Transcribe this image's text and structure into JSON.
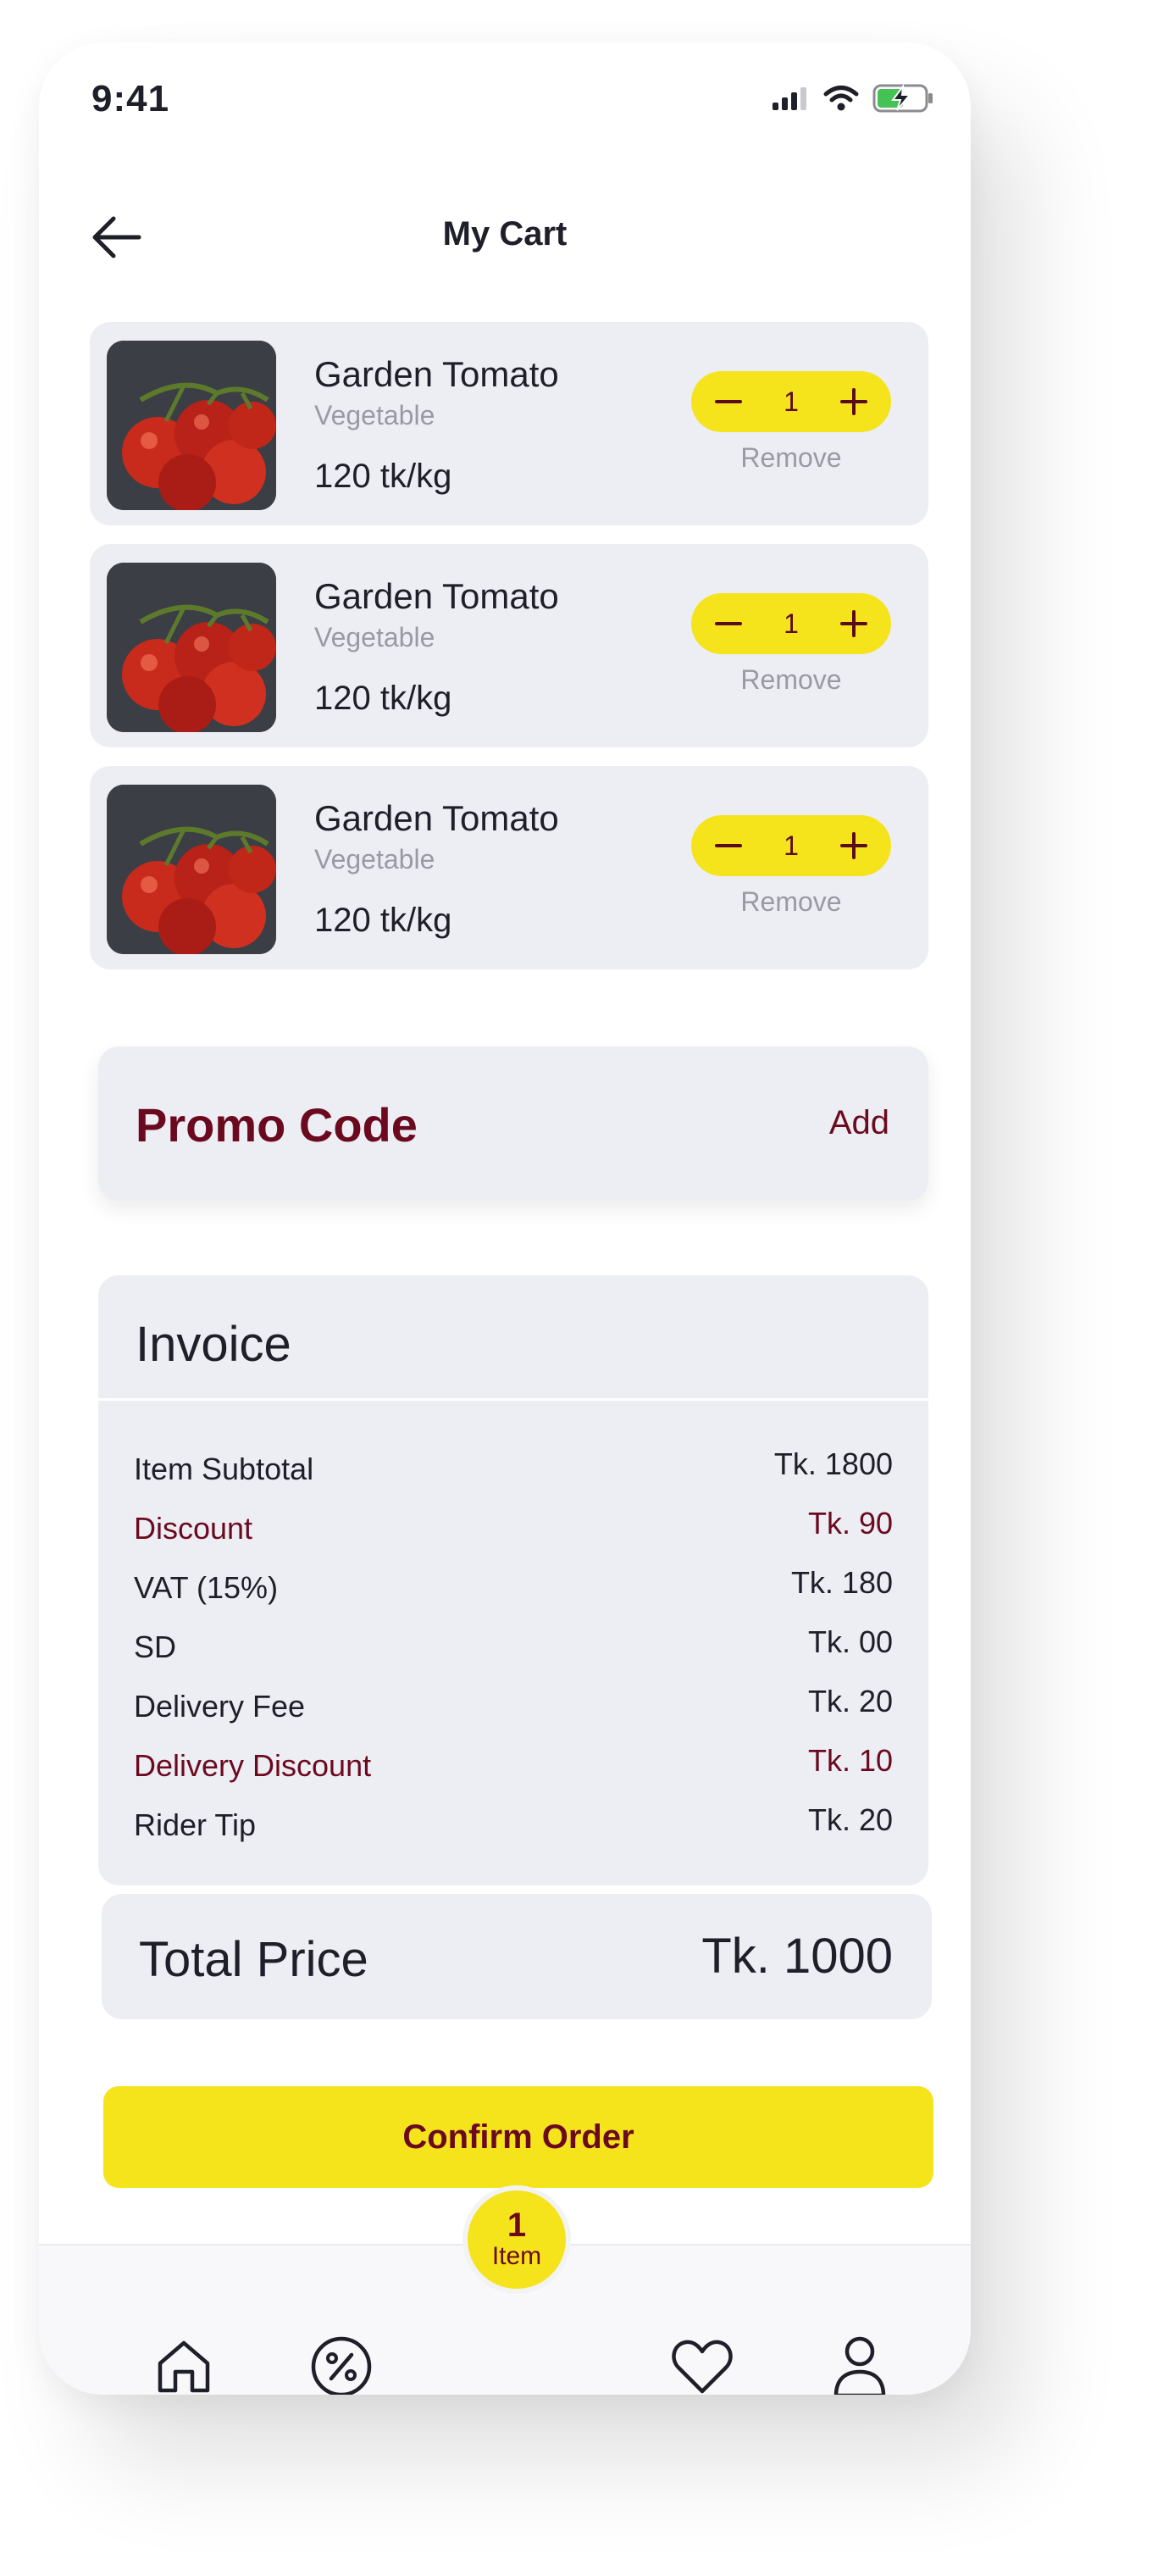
{
  "status_bar": {
    "time": "9:41"
  },
  "header": {
    "title": "My Cart"
  },
  "cart_items": [
    {
      "name": "Garden Tomato",
      "category": "Vegetable",
      "price": "120 tk/kg",
      "quantity": "1",
      "remove_label": "Remove"
    },
    {
      "name": "Garden Tomato",
      "category": "Vegetable",
      "price": "120 tk/kg",
      "quantity": "1",
      "remove_label": "Remove"
    },
    {
      "name": "Garden Tomato",
      "category": "Vegetable",
      "price": "120 tk/kg",
      "quantity": "1",
      "remove_label": "Remove"
    }
  ],
  "promo": {
    "label": "Promo Code",
    "action": "Add"
  },
  "invoice": {
    "title": "Invoice",
    "rows": [
      {
        "label": "Item Subtotal",
        "value": "Tk. 1800"
      },
      {
        "label": "Discount",
        "value": "Tk. 90"
      },
      {
        "label": "VAT (15%)",
        "value": "Tk. 180"
      },
      {
        "label": "SD",
        "value": "Tk. 00"
      },
      {
        "label": "Delivery Fee",
        "value": "Tk. 20"
      },
      {
        "label": "Delivery Discount",
        "value": "Tk. 10"
      },
      {
        "label": "Rider Tip",
        "value": "Tk. 20"
      }
    ]
  },
  "total": {
    "label": "Total Price",
    "value": "Tk. 1000"
  },
  "confirm_button": "Confirm Order",
  "cart_badge": {
    "count": "1",
    "label": "Item"
  },
  "tab_bar": {
    "icons": [
      "home-icon",
      "discount-icon",
      "heart-icon",
      "profile-icon"
    ]
  },
  "colors": {
    "accent": "#F5E31C",
    "brand": "#6B0A1F",
    "card": "#EDEDF4"
  }
}
